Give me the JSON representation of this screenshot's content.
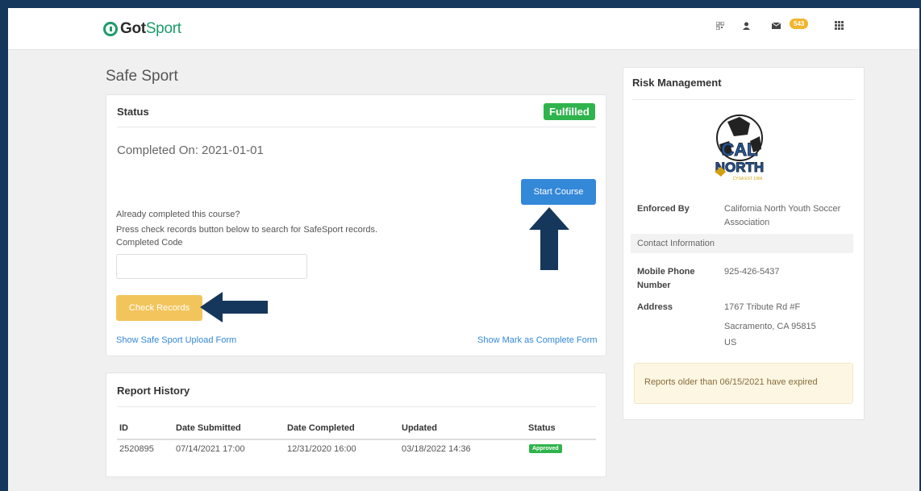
{
  "header": {
    "logo_got": "Got",
    "logo_sport": "Sport",
    "message_count": "543"
  },
  "page": {
    "title": "Safe Sport"
  },
  "status_card": {
    "title": "Status",
    "status_badge": "Fulfilled",
    "completed_on": "Completed On: 2021-01-01",
    "start_course_label": "Start Course",
    "already_completed": "Already completed this course?",
    "press_check": "Press check records button below to search for SafeSport records.",
    "completed_code_label": "Completed Code",
    "completed_code_value": "",
    "check_records_label": "Check Records",
    "upload_form_link": "Show Safe Sport Upload Form",
    "mark_complete_link": "Show Mark as Complete Form"
  },
  "report_history": {
    "title": "Report History",
    "columns": [
      "ID",
      "Date Submitted",
      "Date Completed",
      "Updated",
      "Status"
    ],
    "rows": [
      {
        "id": "2520895",
        "date_submitted": "07/14/2021 17:00",
        "date_completed": "12/31/2020 16:00",
        "updated": "03/18/2022 14:36",
        "status": "Approved"
      }
    ]
  },
  "risk_management": {
    "title": "Risk Management",
    "logo_top": "CAL",
    "logo_bottom": "NORTH",
    "logo_tag": "CYSA EST 1966",
    "enforced_by_label": "Enforced By",
    "enforced_by_value_1": "California North Youth Soccer",
    "enforced_by_value_2": "Association",
    "contact_information": "Contact Information",
    "mobile_label_1": "Mobile Phone",
    "mobile_label_2": "Number",
    "mobile_value": "925-426-5437",
    "address_label": "Address",
    "address_line1": "1767 Tribute Rd #F",
    "address_line2": "Sacramento, CA 95815",
    "address_line3": "US",
    "expired_notice": "Reports older than 06/15/2021 have expired"
  },
  "colors": {
    "background": "#15375c",
    "brand_green": "#1e9c6b",
    "fulfilled_green": "#2fb34c",
    "primary_blue": "#3388d8",
    "check_yellow": "#f2c55c",
    "annotation_arrow": "#15375c"
  }
}
